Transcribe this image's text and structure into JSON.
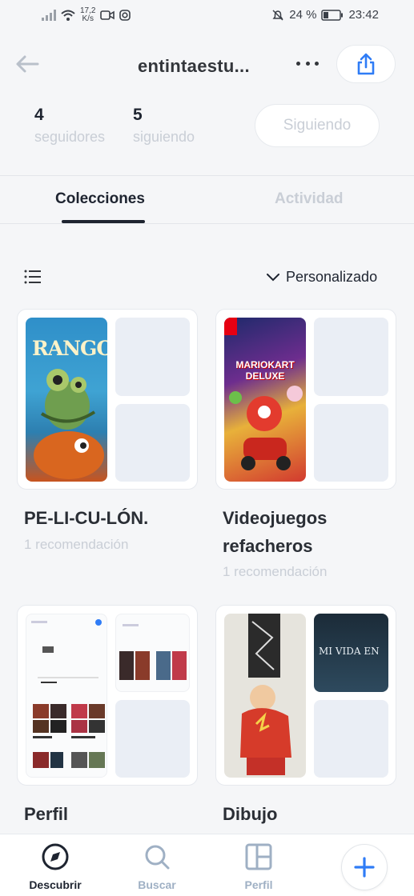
{
  "status_bar": {
    "speed_value": "17,2",
    "speed_unit": "K/s",
    "battery": "24 %",
    "time": "23:42"
  },
  "header": {
    "title": "entintaestu..."
  },
  "stats": {
    "followers": {
      "value": "4",
      "label": "seguidores"
    },
    "following": {
      "value": "5",
      "label": "siguiendo"
    },
    "follow_button": "Siguiendo"
  },
  "tabs": {
    "collections": "Colecciones",
    "activity": "Actividad"
  },
  "controls": {
    "sort_label": "Personalizado"
  },
  "collections": [
    {
      "title": "PE-LI-CU-LÓN.",
      "subtitle": "1 recomendación",
      "cover_text": "RANGO"
    },
    {
      "title_line1": "Videojuegos",
      "title_line2": "refacheros",
      "subtitle": "1 recomendación",
      "cover_text": "MARIOKART DELUXE"
    },
    {
      "title": "Perfil"
    },
    {
      "title": "Dibujo",
      "thumb_text": "MI VIDA EN"
    }
  ],
  "bottom_nav": {
    "discover": "Descubrir",
    "search": "Buscar",
    "profile": "Perfil"
  },
  "colors": {
    "accent": "#2f7cf6",
    "text": "#1e2430",
    "muted": "#c9ced6",
    "background": "#f5f6f8"
  }
}
